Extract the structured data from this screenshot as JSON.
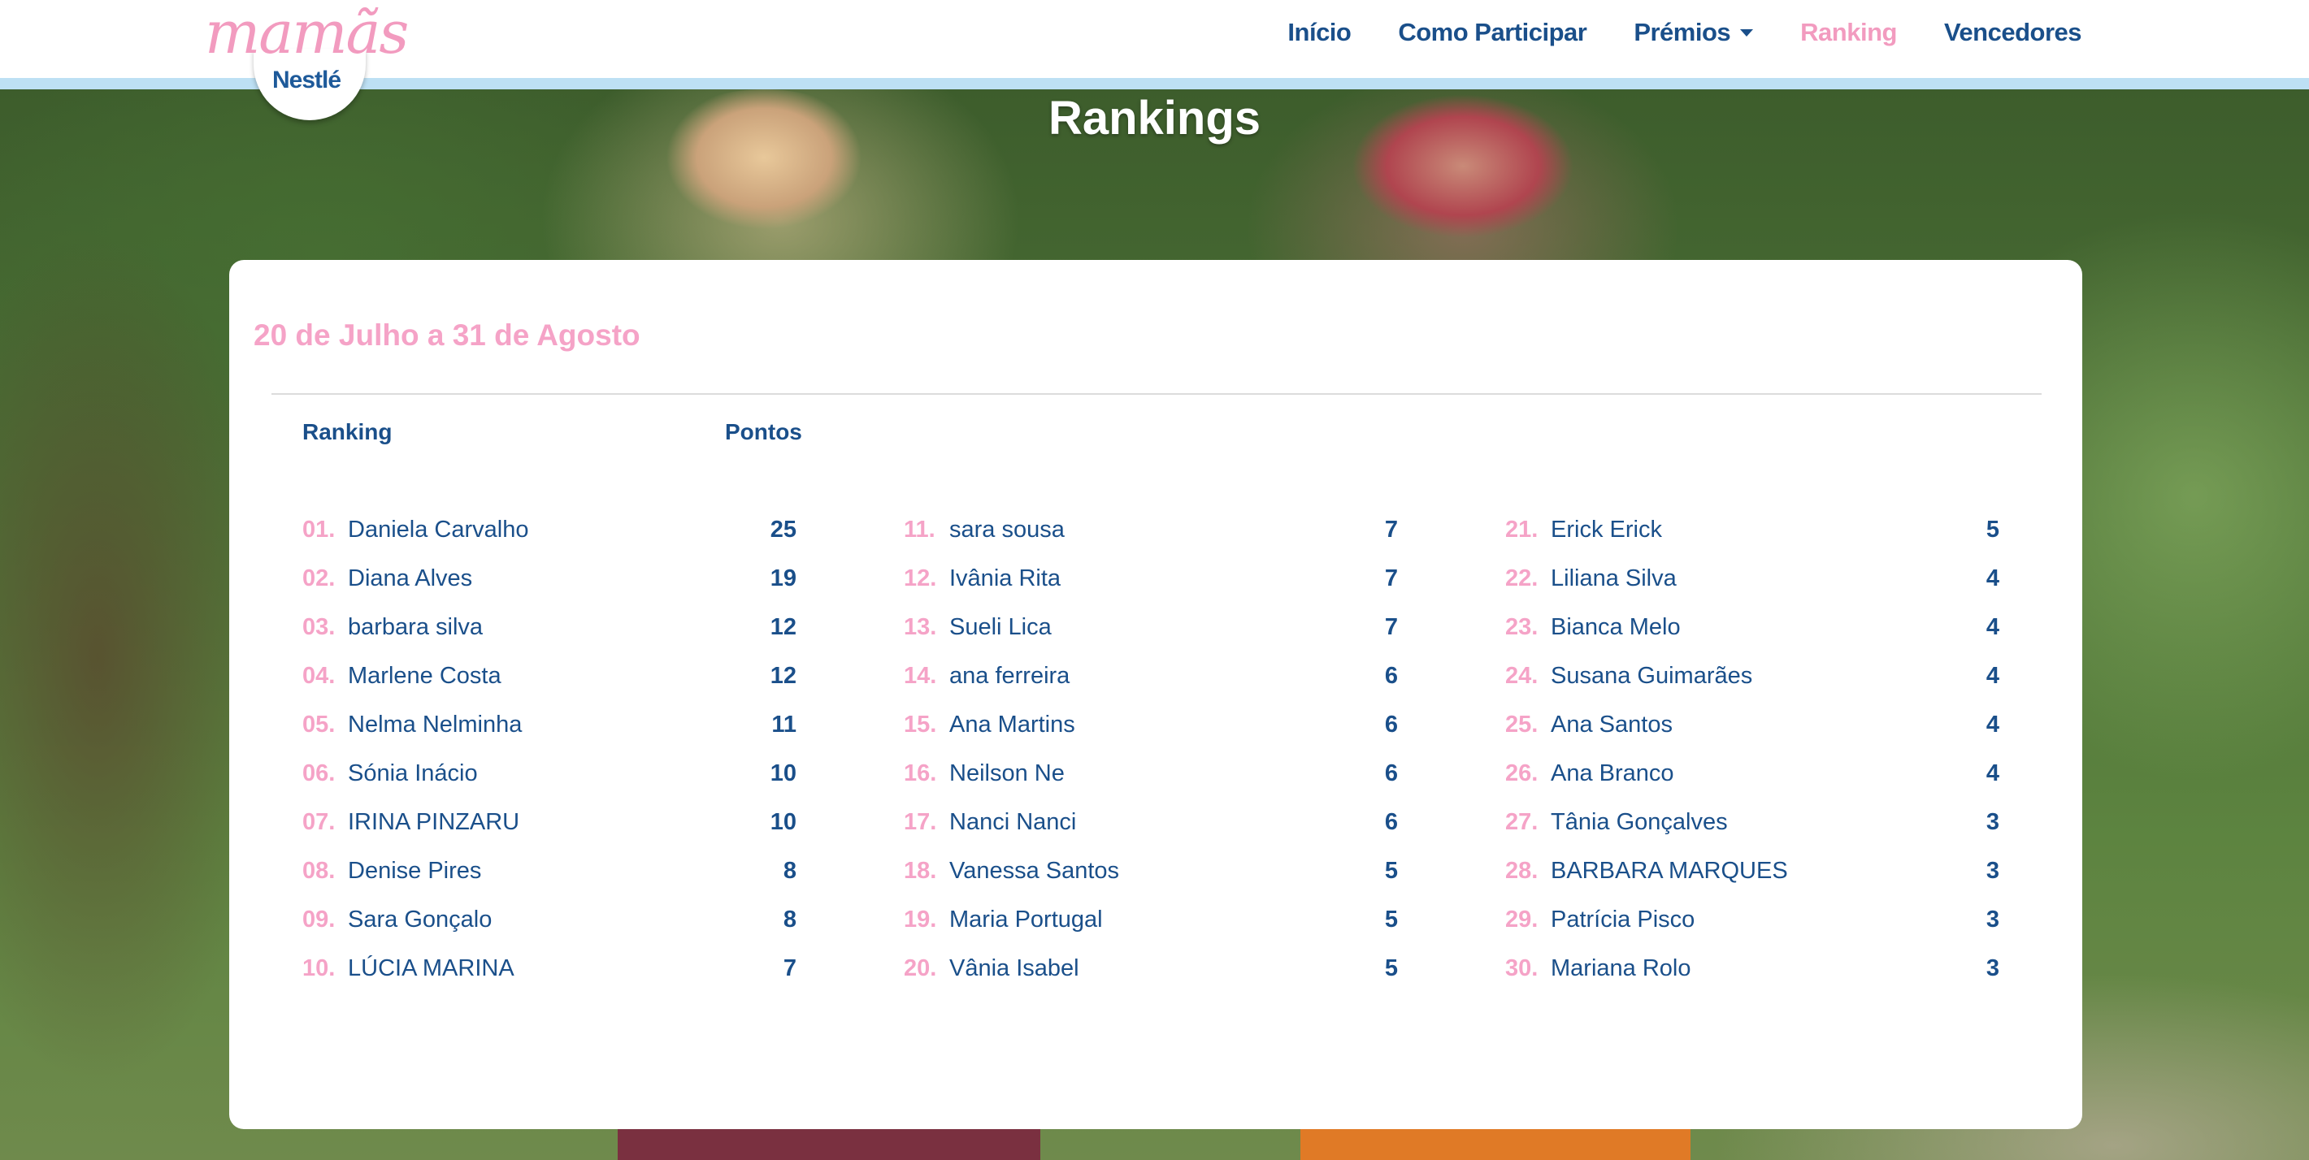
{
  "brand": {
    "script": "mamãs",
    "name": "Nestlé"
  },
  "nav": {
    "items": [
      {
        "label": "Início"
      },
      {
        "label": "Como Participar"
      },
      {
        "label": "Prémios"
      },
      {
        "label": "Ranking"
      },
      {
        "label": "Vencedores"
      }
    ]
  },
  "page": {
    "title": "Rankings"
  },
  "ranking": {
    "period": "20 de Julho a 31 de Agosto",
    "header_rank": "Ranking",
    "header_points": "Pontos",
    "columns": [
      [
        {
          "pos": "01.",
          "name": "Daniela Carvalho",
          "points": "25"
        },
        {
          "pos": "02.",
          "name": "Diana Alves",
          "points": "19"
        },
        {
          "pos": "03.",
          "name": "barbara silva",
          "points": "12"
        },
        {
          "pos": "04.",
          "name": "Marlene Costa",
          "points": "12"
        },
        {
          "pos": "05.",
          "name": "Nelma Nelminha",
          "points": "11"
        },
        {
          "pos": "06.",
          "name": "Sónia Inácio",
          "points": "10"
        },
        {
          "pos": "07.",
          "name": "IRINA PINZARU",
          "points": "10"
        },
        {
          "pos": "08.",
          "name": "Denise Pires",
          "points": "8"
        },
        {
          "pos": "09.",
          "name": "Sara Gonçalo",
          "points": "8"
        },
        {
          "pos": "10.",
          "name": "LÚCIA MARINA",
          "points": "7"
        }
      ],
      [
        {
          "pos": "11.",
          "name": "sara sousa",
          "points": "7"
        },
        {
          "pos": "12.",
          "name": "Ivânia Rita",
          "points": "7"
        },
        {
          "pos": "13.",
          "name": "Sueli Lica",
          "points": "7"
        },
        {
          "pos": "14.",
          "name": "ana ferreira",
          "points": "6"
        },
        {
          "pos": "15.",
          "name": "Ana Martins",
          "points": "6"
        },
        {
          "pos": "16.",
          "name": "Neilson Ne",
          "points": "6"
        },
        {
          "pos": "17.",
          "name": "Nanci Nanci",
          "points": "6"
        },
        {
          "pos": "18.",
          "name": "Vanessa Santos",
          "points": "5"
        },
        {
          "pos": "19.",
          "name": "Maria Portugal",
          "points": "5"
        },
        {
          "pos": "20.",
          "name": "Vânia Isabel",
          "points": "5"
        }
      ],
      [
        {
          "pos": "21.",
          "name": "Erick Erick",
          "points": "5"
        },
        {
          "pos": "22.",
          "name": "Liliana Silva",
          "points": "4"
        },
        {
          "pos": "23.",
          "name": "Bianca Melo",
          "points": "4"
        },
        {
          "pos": "24.",
          "name": "Susana Guimarães",
          "points": "4"
        },
        {
          "pos": "25.",
          "name": "Ana Santos",
          "points": "4"
        },
        {
          "pos": "26.",
          "name": "Ana Branco",
          "points": "4"
        },
        {
          "pos": "27.",
          "name": "Tânia Gonçalves",
          "points": "3"
        },
        {
          "pos": "28.",
          "name": "BARBARA MARQUES",
          "points": "3"
        },
        {
          "pos": "29.",
          "name": "Patrícia Pisco",
          "points": "3"
        },
        {
          "pos": "30.",
          "name": "Mariana Rolo",
          "points": "3"
        }
      ]
    ]
  },
  "carousel": {
    "prev_icon": "chevron-left-icon",
    "next_icon": "chevron-right-icon"
  },
  "colors": {
    "navy": "#1a4f8a",
    "pink": "#f5a3c7",
    "stripe": "#bde0f4"
  }
}
